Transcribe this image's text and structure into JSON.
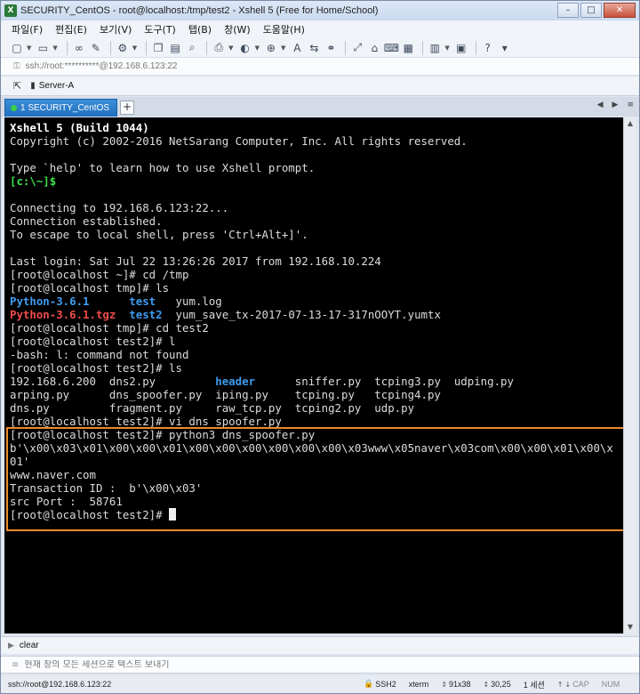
{
  "window": {
    "title": "SECURITY_CentOS - root@localhost:/tmp/test2 - Xshell 5 (Free for Home/School)",
    "icon": "xshell-icon",
    "controls": {
      "minimize": "–",
      "maximize": "□",
      "close": "✕"
    }
  },
  "menu": [
    "파일(F)",
    "편집(E)",
    "보기(V)",
    "도구(T)",
    "탭(B)",
    "창(W)",
    "도움말(H)"
  ],
  "address": {
    "text": "ssh://root:**********@192.168.6.123:22"
  },
  "links": {
    "session": "Server-A"
  },
  "tabs": {
    "active": "1 SECURITY_CentOS",
    "add": "+",
    "prev": "◀",
    "next": "▶",
    "menu": "≡"
  },
  "terminal": {
    "lines": [
      [
        {
          "t": "Xshell 5 (Build 1044)",
          "c": "b"
        }
      ],
      [
        {
          "t": "Copyright (c) 2002-2016 NetSarang Computer, Inc. All rights reserved."
        }
      ],
      [
        {
          "t": ""
        }
      ],
      [
        {
          "t": "Type `help' to learn how to use Xshell prompt."
        }
      ],
      [
        {
          "t": "[c:\\~]$",
          "c": "green"
        }
      ],
      [
        {
          "t": ""
        }
      ],
      [
        {
          "t": "Connecting to 192.168.6.123:22..."
        }
      ],
      [
        {
          "t": "Connection established."
        }
      ],
      [
        {
          "t": "To escape to local shell, press 'Ctrl+Alt+]'."
        }
      ],
      [
        {
          "t": ""
        }
      ],
      [
        {
          "t": "Last login: Sat Jul 22 13:26:26 2017 from 192.168.10.224"
        }
      ],
      [
        {
          "t": "[root@localhost ~]# cd /tmp"
        }
      ],
      [
        {
          "t": "[root@localhost tmp]# ls"
        }
      ],
      [
        {
          "t": "Python-3.6.1",
          "c": "blue"
        },
        {
          "t": "      "
        },
        {
          "t": "test",
          "c": "blue"
        },
        {
          "t": "   yum.log"
        }
      ],
      [
        {
          "t": "Python-3.6.1.tgz",
          "c": "red"
        },
        {
          "t": "  "
        },
        {
          "t": "test2",
          "c": "blue"
        },
        {
          "t": "  yum_save_tx-2017-07-13-17-317nOOYT.yumtx"
        }
      ],
      [
        {
          "t": "[root@localhost tmp]# cd test2"
        }
      ],
      [
        {
          "t": "[root@localhost test2]# l"
        }
      ],
      [
        {
          "t": "-bash: l: command not found"
        }
      ],
      [
        {
          "t": "[root@localhost test2]# ls"
        }
      ],
      [
        {
          "t": "192.168.6.200  dns2.py         "
        },
        {
          "t": "header",
          "c": "blue"
        },
        {
          "t": "      sniffer.py  tcping3.py  udping.py"
        }
      ],
      [
        {
          "t": "arping.py      dns_spoofer.py  iping.py    tcping.py   tcping4.py"
        }
      ],
      [
        {
          "t": "dns.py         fragment.py     raw_tcp.py  tcping2.py  udp.py"
        }
      ],
      [
        {
          "t": "[root@localhost test2]# vi dns_spoofer.py"
        }
      ],
      [
        {
          "t": "[root@localhost test2]# python3 dns_spoofer.py"
        }
      ],
      [
        {
          "t": "b'\\x00\\x03\\x01\\x00\\x00\\x01\\x00\\x00\\x00\\x00\\x00\\x00\\x03www\\x05naver\\x03com\\x00\\x00\\x01\\x00\\x"
        }
      ],
      [
        {
          "t": "01'"
        }
      ],
      [
        {
          "t": "www.naver.com"
        }
      ],
      [
        {
          "t": "Transaction ID :  b'\\x00\\x03'"
        }
      ],
      [
        {
          "t": "src Port :  58761"
        }
      ],
      [
        {
          "t": "[root@localhost test2]# "
        },
        {
          "cursor": true
        }
      ]
    ]
  },
  "command_bar": {
    "label": "clear"
  },
  "compose_bar": {
    "placeholder": "현재 창의 모든 세션으로 텍스트 보내기"
  },
  "status": {
    "connection": "ssh://root@192.168.6.123:22",
    "protocol": "SSH2",
    "terminal": "xterm",
    "size": "91x38",
    "cursor_pos": "30,25",
    "sessions": "1 세션",
    "cap": "CAP",
    "num": "NUM"
  },
  "colors": {
    "terminal_bg": "#000000",
    "terminal_fg": "#dcdcdc",
    "prompt_green": "#3fe34a",
    "dir_blue": "#3e9cf0",
    "archive_red": "#ef4b4b",
    "highlight_orange": "#ef8a2a",
    "tab_active": "#1f6fbf"
  }
}
